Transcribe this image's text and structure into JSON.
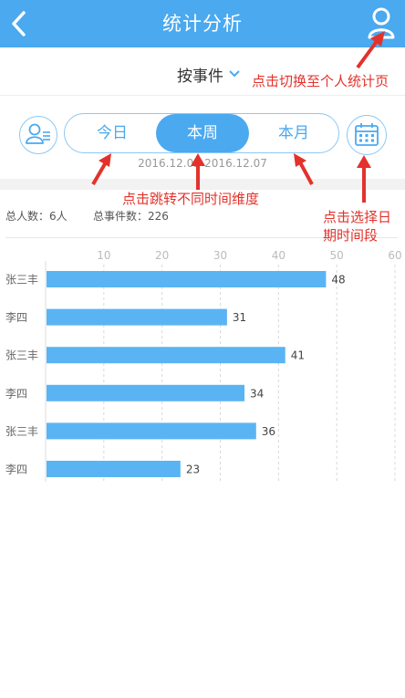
{
  "header": {
    "title": "统计分析"
  },
  "filter": {
    "event_label": "按事件"
  },
  "range": {
    "tabs": [
      {
        "label": "今日"
      },
      {
        "label": "本周"
      },
      {
        "label": "本月"
      }
    ],
    "active_index": 1,
    "date_range": "2016.12.02-2016.12.07"
  },
  "summary": {
    "total_people": "总人数：6人",
    "total_events": "总事件数：226"
  },
  "annotations": {
    "switch_personal": "点击切换至个人统计页",
    "jump_time": "点击跳转不同时间维度",
    "select_date": [
      "点击选择日",
      "期时间段"
    ]
  },
  "colors": {
    "accent": "#4aa9ef",
    "annotation": "#e3322b",
    "bar": "#5ab4f4"
  },
  "chart_data": {
    "type": "bar",
    "orientation": "horizontal",
    "categories": [
      "张三丰",
      "李四",
      "张三丰",
      "李四",
      "张三丰",
      "李四"
    ],
    "values": [
      48,
      31,
      41,
      34,
      36,
      23
    ],
    "xlim": [
      0,
      60
    ],
    "xticks": [
      10,
      20,
      30,
      40,
      50,
      60
    ],
    "grid": true,
    "data_labels": true
  }
}
